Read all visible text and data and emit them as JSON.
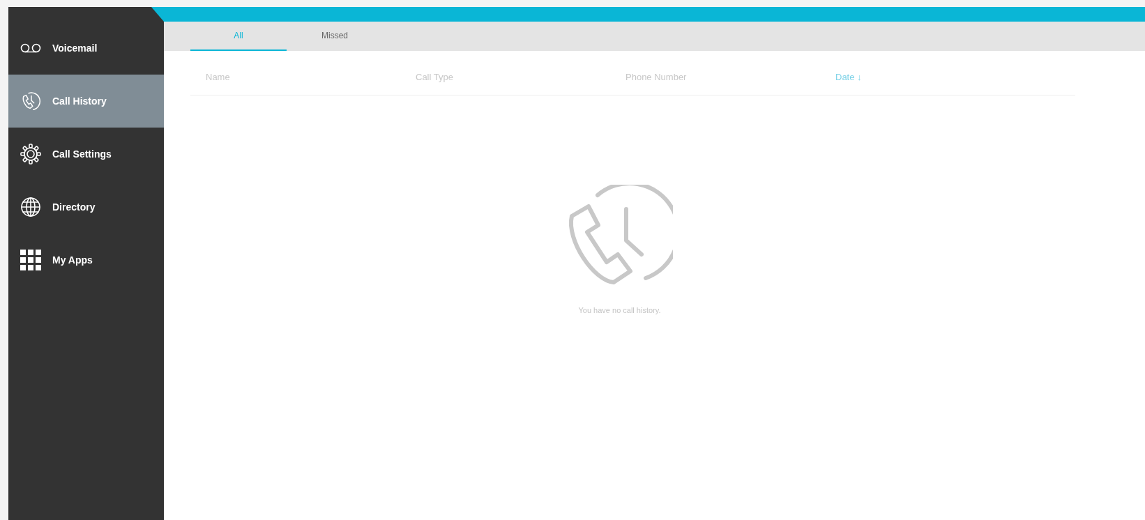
{
  "sidebar": {
    "items": [
      {
        "kind": "voicemail",
        "label": "Voicemail",
        "selected": false
      },
      {
        "kind": "history",
        "label": "Call History",
        "selected": true
      },
      {
        "kind": "settings",
        "label": "Call Settings",
        "selected": false
      },
      {
        "kind": "directory",
        "label": "Directory",
        "selected": false
      },
      {
        "kind": "apps",
        "label": "My Apps",
        "selected": false
      }
    ]
  },
  "tabs": [
    {
      "label": "All",
      "selected": true
    },
    {
      "label": "Missed",
      "selected": false
    }
  ],
  "table": {
    "columns": [
      {
        "label": "Name",
        "sorted": false
      },
      {
        "label": "Call Type",
        "sorted": false
      },
      {
        "label": "Phone Number",
        "sorted": false
      },
      {
        "label": "Date",
        "sorted": true,
        "sort_arrow": "↓"
      }
    ]
  },
  "empty_state": {
    "message": "You have no call history."
  }
}
